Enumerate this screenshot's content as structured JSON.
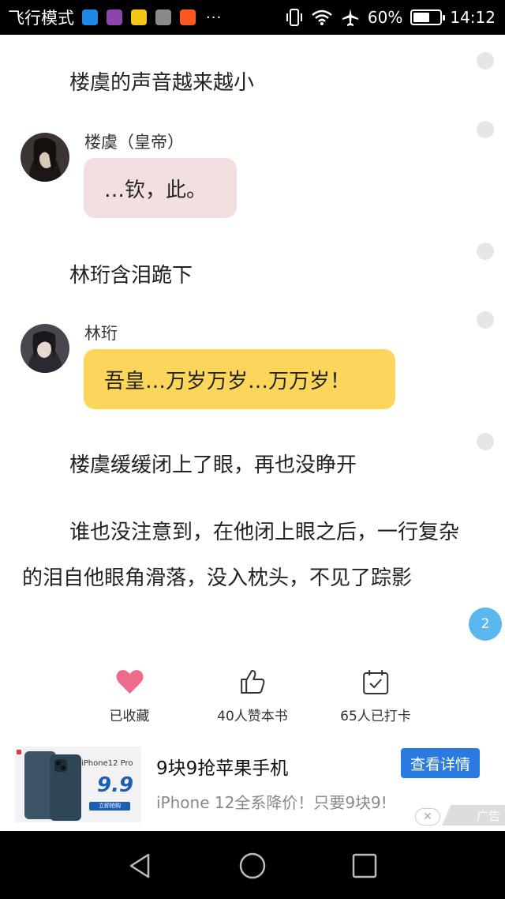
{
  "status_bar": {
    "left_text": "飞行模式",
    "more": "···",
    "battery_percent_text": "60%",
    "battery_level": 0.6,
    "time": "14:12",
    "app_icon_colors": [
      "#1e88e5",
      "#8e44ad",
      "#f5c518",
      "#8a8a8a",
      "#ff5722"
    ]
  },
  "story": {
    "narration_1": "楼虞的声音越来越小",
    "dialogue_1": {
      "speaker": "楼虞（皇帝）",
      "text": "…钦，此。",
      "bubble_color": "#f4dfe0"
    },
    "narration_2": "林珩含泪跪下",
    "dialogue_2": {
      "speaker": "林珩",
      "text": "吾皇…万岁万岁…万万岁！",
      "bubble_color": "#fbd65b"
    },
    "narration_3": "楼虞缓缓闭上了眼，再也没睁开",
    "paragraph": "谁也没注意到，在他闭上眼之后，一行复杂的泪自他眼角滑落，没入枕头，不见了踪影",
    "page_badge": "2"
  },
  "actions": [
    {
      "label": "已收藏",
      "icon": "heart-icon",
      "color": "#f06a8a"
    },
    {
      "label": "40人赞本书",
      "icon": "thumbs-up-icon"
    },
    {
      "label": "65人已打卡",
      "icon": "calendar-check-icon"
    }
  ],
  "ad": {
    "title": "9块9抢苹果手机",
    "cta": "查看详情",
    "description": "iPhone 12全系降价！只要9块9!",
    "tag": "广告",
    "image_product": "iPhone12 Pro",
    "image_price": "9.9",
    "image_button": "立即抢购",
    "cta_color": "#2a7ae2"
  }
}
